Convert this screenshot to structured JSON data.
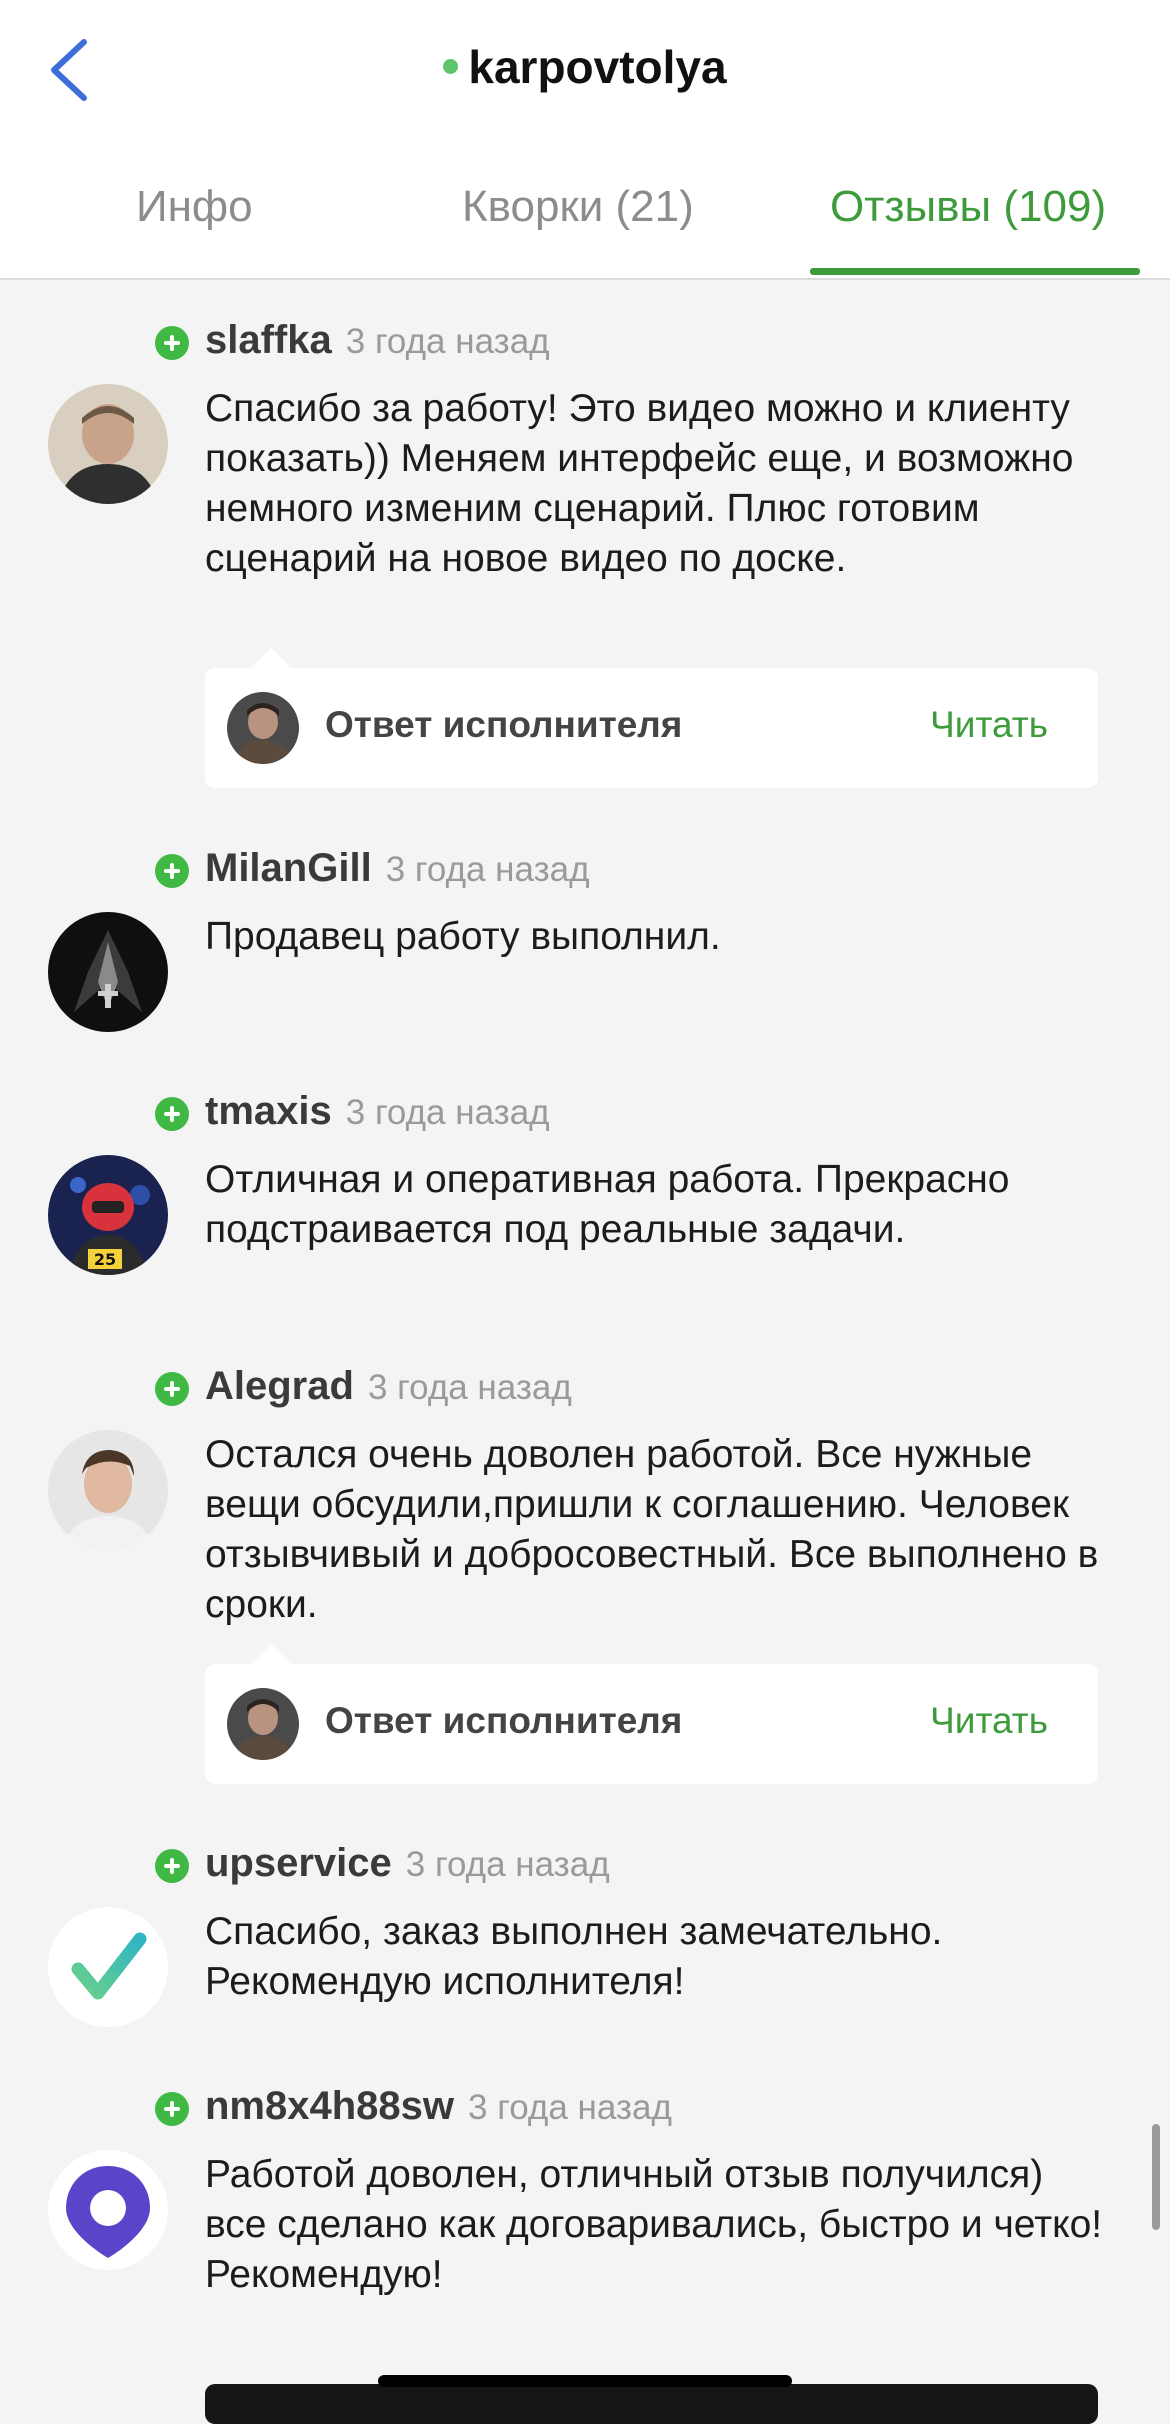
{
  "header": {
    "title": "karpovtolya",
    "online_color": "#5ec56a",
    "back_icon": "chevron-left-icon"
  },
  "tabs": [
    {
      "label": "Инфо",
      "active": false
    },
    {
      "label": "Кворки (21)",
      "active": false
    },
    {
      "label": "Отзывы (109)",
      "active": true
    }
  ],
  "colors": {
    "accent": "#3d9b3b",
    "badge": "#3fb944"
  },
  "reviews": [
    {
      "user": "slaffka",
      "time": "3 года назад",
      "text": "Спасибо за работу! Это видео можно и клиенту показать)) Меняем интерфейс еще, и возможно немного изменим сценарий. Плюс готовим сценарий на новое видео по доске.",
      "reply": {
        "label": "Ответ исполнителя",
        "action": "Читать"
      }
    },
    {
      "user": "MilanGill",
      "time": "3 года назад",
      "text": "Продавец работу выполнил."
    },
    {
      "user": "tmaxis",
      "time": "3 года назад",
      "text": "Отличная и оперативная работа. Прекрасно подстраивается под реальные задачи."
    },
    {
      "user": "Alegrad",
      "time": "3 года назад",
      "text": "Остался очень доволен работой. Все нужные вещи обсудили,пришли к соглашению. Человек отзывчивый и добросовестный. Все выполнено в сроки.",
      "reply": {
        "label": "Ответ исполнителя",
        "action": "Читать"
      }
    },
    {
      "user": "upservice",
      "time": "3 года назад",
      "text": "Спасибо, заказ выполнен замечательно. Рекомендую исполнителя!"
    },
    {
      "user": "nm8x4h88sw",
      "time": "3 года назад",
      "text": "Работой доволен, отличный отзыв получился) все сделано как договаривались, быстро и четко! Рекомендую!"
    }
  ]
}
